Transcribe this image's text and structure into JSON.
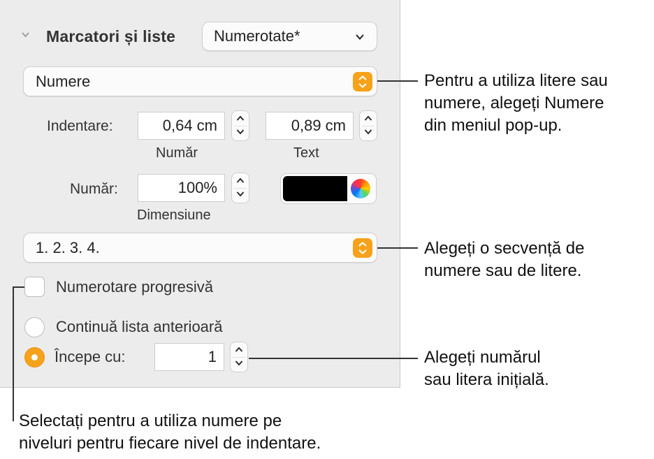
{
  "panel": {
    "section_title": "Marcatori și liste",
    "list_style": "Numerotate*",
    "bullet_type": "Numere",
    "indent": {
      "label": "Indentare:",
      "number_value": "0,64 cm",
      "number_label": "Număr",
      "text_value": "0,89 cm",
      "text_label": "Text"
    },
    "number_size": {
      "label": "Număr:",
      "value": "100%",
      "sublabel": "Dimensiune"
    },
    "color": {
      "swatch": "#000000"
    },
    "sequence": "1. 2. 3. 4.",
    "tiered_numbers": {
      "label": "Numerotare progresivă",
      "checked": false
    },
    "continue_previous": {
      "label": "Continuă lista anterioară",
      "selected": false
    },
    "start_at": {
      "label": "Începe cu:",
      "value": "1",
      "selected": true
    }
  },
  "callouts": {
    "bullet_type": [
      "Pentru a utiliza litere sau",
      "numere, alegeți Numere",
      "din meniul pop-up."
    ],
    "sequence": [
      "Alegeți o secvență de",
      "numere sau de litere."
    ],
    "start_at": [
      "Alegeți numărul",
      "sau litera inițială."
    ],
    "tiered": [
      "Selectați pentru a utiliza numere pe",
      "niveluri pentru fiecare nivel de indentare."
    ]
  },
  "colors": {
    "accent": "#f7a21b",
    "panel_bg": "#ececec"
  }
}
